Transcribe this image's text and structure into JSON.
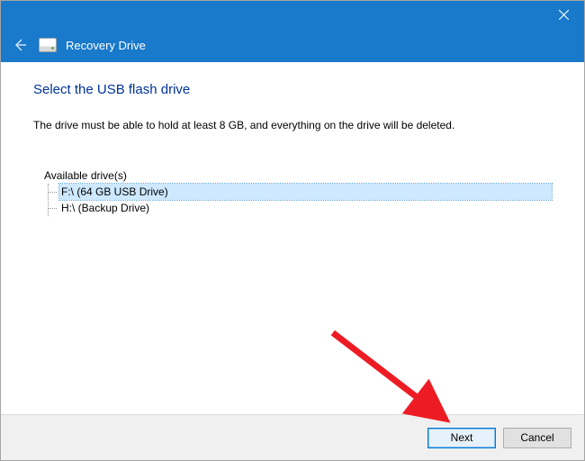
{
  "colors": {
    "accent": "#1979ca",
    "heading": "#003399",
    "arrow": "#ed1c24"
  },
  "titlebar": {
    "close_icon": "close-icon"
  },
  "header": {
    "back_icon": "back-arrow-icon",
    "drive_icon": "drive-icon",
    "title": "Recovery Drive"
  },
  "page": {
    "heading": "Select the USB flash drive",
    "instruction": "The drive must be able to hold at least 8 GB, and everything on the drive will be deleted."
  },
  "drive_tree": {
    "root_label": "Available drive(s)",
    "items": [
      {
        "label": "F:\\ (64 GB USB Drive)",
        "selected": true
      },
      {
        "label": "H:\\ (Backup Drive)",
        "selected": false
      }
    ]
  },
  "footer": {
    "next_label": "Next",
    "cancel_label": "Cancel"
  },
  "annotation": {
    "arrow_icon": "annotation-arrow"
  }
}
